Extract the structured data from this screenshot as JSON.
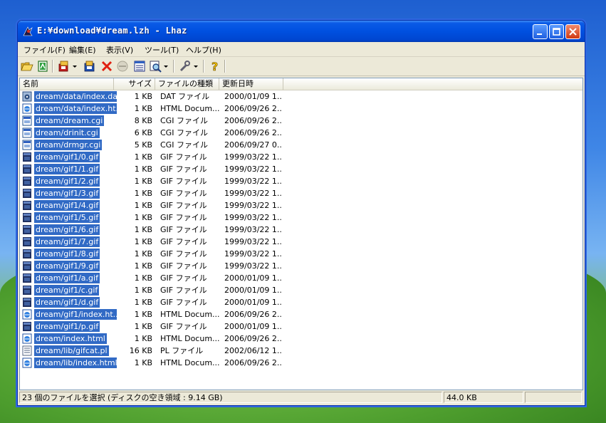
{
  "window": {
    "title": "E:¥download¥dream.lzh - Lhaz"
  },
  "menu": [
    "ファイル(F)",
    "編集(E)",
    "表示(V)",
    "ツール(T)",
    "ヘルプ(H)"
  ],
  "toolbar": {
    "icons": [
      "open-folder-icon",
      "new-archive-icon",
      "extract-icon",
      "add-files-icon",
      "delete-icon",
      "disabled-icon",
      "properties-icon",
      "view-icon",
      "tools-icon",
      "help-icon"
    ]
  },
  "columns": [
    "名前",
    "サイズ",
    "ファイルの種類",
    "更新日時"
  ],
  "files": [
    {
      "name": "dream/data/index.dat",
      "size": "1 KB",
      "type": "DAT ファイル",
      "date": "2000/01/09 1...",
      "icon": "dat"
    },
    {
      "name": "dream/data/index.ht...",
      "size": "1 KB",
      "type": "HTML Docum...",
      "date": "2006/09/26 2...",
      "icon": "html"
    },
    {
      "name": "dream/dream.cgi",
      "size": "8 KB",
      "type": "CGI ファイル",
      "date": "2006/09/26 2...",
      "icon": "cgi"
    },
    {
      "name": "dream/drinit.cgi",
      "size": "6 KB",
      "type": "CGI ファイル",
      "date": "2006/09/26 2...",
      "icon": "cgi"
    },
    {
      "name": "dream/drmgr.cgi",
      "size": "5 KB",
      "type": "CGI ファイル",
      "date": "2006/09/27 0...",
      "icon": "cgi"
    },
    {
      "name": "dream/gif1/0.gif",
      "size": "1 KB",
      "type": "GIF ファイル",
      "date": "1999/03/22 1...",
      "icon": "gif"
    },
    {
      "name": "dream/gif1/1.gif",
      "size": "1 KB",
      "type": "GIF ファイル",
      "date": "1999/03/22 1...",
      "icon": "gif"
    },
    {
      "name": "dream/gif1/2.gif",
      "size": "1 KB",
      "type": "GIF ファイル",
      "date": "1999/03/22 1...",
      "icon": "gif"
    },
    {
      "name": "dream/gif1/3.gif",
      "size": "1 KB",
      "type": "GIF ファイル",
      "date": "1999/03/22 1...",
      "icon": "gif"
    },
    {
      "name": "dream/gif1/4.gif",
      "size": "1 KB",
      "type": "GIF ファイル",
      "date": "1999/03/22 1...",
      "icon": "gif"
    },
    {
      "name": "dream/gif1/5.gif",
      "size": "1 KB",
      "type": "GIF ファイル",
      "date": "1999/03/22 1...",
      "icon": "gif"
    },
    {
      "name": "dream/gif1/6.gif",
      "size": "1 KB",
      "type": "GIF ファイル",
      "date": "1999/03/22 1...",
      "icon": "gif"
    },
    {
      "name": "dream/gif1/7.gif",
      "size": "1 KB",
      "type": "GIF ファイル",
      "date": "1999/03/22 1...",
      "icon": "gif"
    },
    {
      "name": "dream/gif1/8.gif",
      "size": "1 KB",
      "type": "GIF ファイル",
      "date": "1999/03/22 1...",
      "icon": "gif"
    },
    {
      "name": "dream/gif1/9.gif",
      "size": "1 KB",
      "type": "GIF ファイル",
      "date": "1999/03/22 1...",
      "icon": "gif"
    },
    {
      "name": "dream/gif1/a.gif",
      "size": "1 KB",
      "type": "GIF ファイル",
      "date": "2000/01/09 1...",
      "icon": "gif"
    },
    {
      "name": "dream/gif1/c.gif",
      "size": "1 KB",
      "type": "GIF ファイル",
      "date": "2000/01/09 1...",
      "icon": "gif"
    },
    {
      "name": "dream/gif1/d.gif",
      "size": "1 KB",
      "type": "GIF ファイル",
      "date": "2000/01/09 1...",
      "icon": "gif"
    },
    {
      "name": "dream/gif1/index.ht...",
      "size": "1 KB",
      "type": "HTML Docum...",
      "date": "2006/09/26 2...",
      "icon": "html"
    },
    {
      "name": "dream/gif1/p.gif",
      "size": "1 KB",
      "type": "GIF ファイル",
      "date": "2000/01/09 1...",
      "icon": "gif"
    },
    {
      "name": "dream/index.html",
      "size": "1 KB",
      "type": "HTML Docum...",
      "date": "2006/09/26 2...",
      "icon": "html"
    },
    {
      "name": "dream/lib/gifcat.pl",
      "size": "16 KB",
      "type": "PL ファイル",
      "date": "2002/06/12 1...",
      "icon": "pl"
    },
    {
      "name": "dream/lib/index.html",
      "size": "1 KB",
      "type": "HTML Docum...",
      "date": "2006/09/26 2...",
      "icon": "html"
    }
  ],
  "status": {
    "selection": "23 個のファイルを選択 (ディスクの空き領域 : 9.14 GB)",
    "size": "44.0 KB",
    "extra": ""
  },
  "colors": {
    "selection": "#316ac5",
    "titlebar": "#0050e0",
    "window_bg": "#ece9d8"
  }
}
